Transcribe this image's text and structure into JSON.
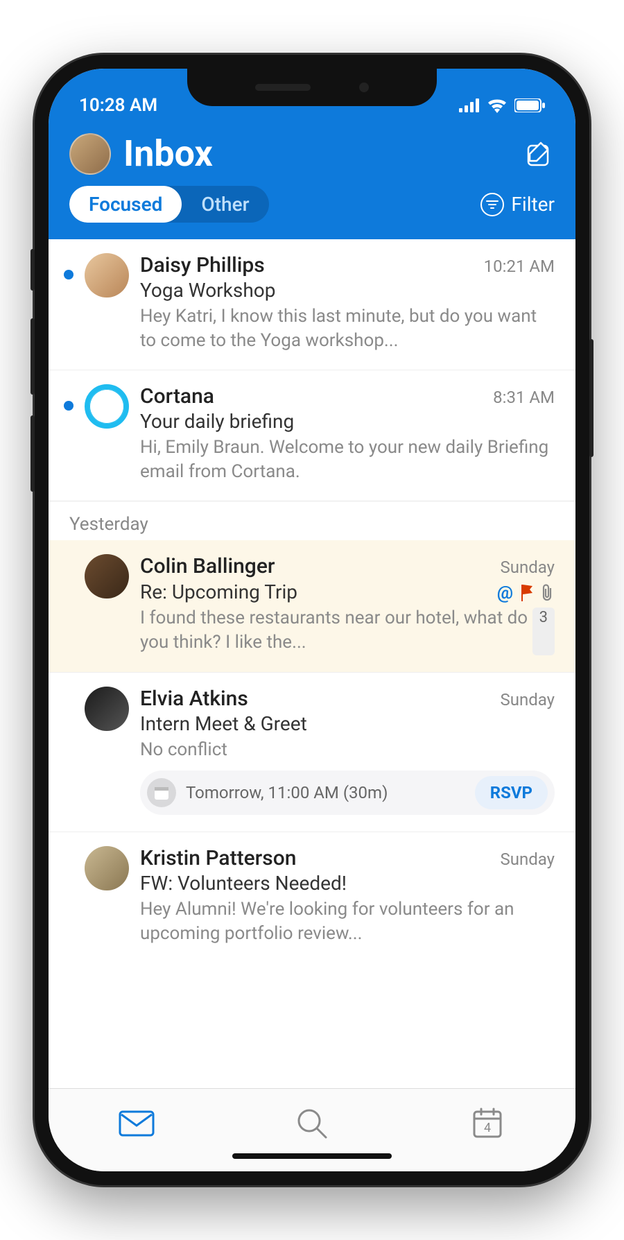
{
  "status": {
    "time": "10:28 AM"
  },
  "header": {
    "title": "Inbox",
    "tabs": {
      "focused": "Focused",
      "other": "Other"
    },
    "filter_label": "Filter"
  },
  "groups": {
    "today": {
      "items": [
        {
          "sender": "Daisy Phillips",
          "time": "10:21 AM",
          "subject": "Yoga Workshop",
          "preview": "Hey Katri, I know this last minute, but do you want to come to the Yoga workshop...",
          "unread": true
        },
        {
          "sender": "Cortana",
          "time": "8:31 AM",
          "subject": "Your daily briefing",
          "preview": "Hi, Emily Braun. Welcome to your new daily Briefing email from Cortana.",
          "unread": true
        }
      ]
    },
    "yesterday": {
      "label": "Yesterday",
      "items": [
        {
          "sender": "Colin Ballinger",
          "time": "Sunday",
          "subject": "Re: Upcoming Trip",
          "preview": "I found these restaurants near our hotel, what do you think? I like the...",
          "count": "3",
          "highlight": true,
          "mention": true,
          "flag": true,
          "attachment": true
        },
        {
          "sender": "Elvia Atkins",
          "time": "Sunday",
          "subject": "Intern Meet & Greet",
          "preview": "No conflict",
          "event": {
            "text": "Tomorrow, 11:00 AM (30m)",
            "rsvp": "RSVP"
          }
        },
        {
          "sender": "Kristin Patterson",
          "time": "Sunday",
          "subject": "FW: Volunteers Needed!",
          "preview": "Hey Alumni! We're looking for volunteers for an upcoming portfolio review..."
        }
      ]
    }
  },
  "nav": {
    "calendar_day": "4"
  }
}
